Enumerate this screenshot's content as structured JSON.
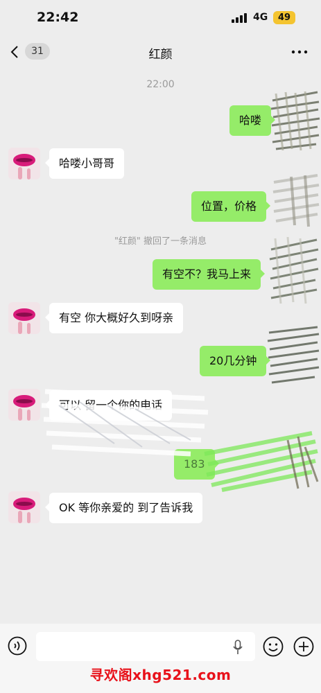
{
  "status_bar": {
    "time": "22:42",
    "network": "4G",
    "battery": "49"
  },
  "nav": {
    "unread_count": "31",
    "title": "红颜"
  },
  "timestamp": "22:00",
  "recall_notice": "\"红颜\" 撤回了一条消息",
  "messages": [
    {
      "side": "out",
      "text": "哈喽"
    },
    {
      "side": "in",
      "text": "哈喽小哥哥"
    },
    {
      "side": "out",
      "text": "位置，价格"
    },
    {
      "side": "out",
      "text": "有空不？我马上来"
    },
    {
      "side": "in",
      "text": "有空 你大概好久到呀亲"
    },
    {
      "side": "out",
      "text": "20几分钟"
    },
    {
      "side": "in",
      "text": "可以 留一个你的电话"
    },
    {
      "side": "out",
      "text": "183"
    },
    {
      "side": "in",
      "text": "OK 等你亲爱的 到了告诉我"
    }
  ],
  "watermark": "寻欢阁xhg521.com",
  "colors": {
    "background": "#ededed",
    "outgoing_bubble": "#95ec69",
    "incoming_bubble": "#ffffff",
    "watermark": "#e8111a"
  },
  "icons": [
    "chevron-left-icon",
    "more-icon",
    "voice-icon",
    "mic-icon",
    "emoji-icon",
    "plus-icon"
  ]
}
